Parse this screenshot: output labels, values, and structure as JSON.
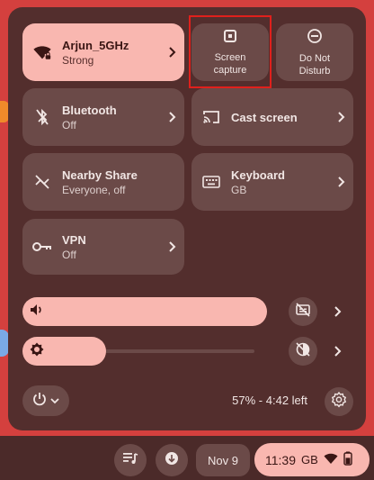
{
  "colors": {
    "wallpaper": "#d4403e",
    "panel": "#532e2d",
    "tile": "#6b4a48",
    "tile_active": "#f9b7b0",
    "shelf": "#4b2a29",
    "highlight": "#e0201c"
  },
  "tiles": {
    "wifi": {
      "title": "Arjun_5GHz",
      "subtitle": "Strong",
      "icon": "wifi-locked-icon",
      "active": true
    },
    "screen_capture": {
      "label": "Screen\ncapture",
      "icon": "screen-capture-icon"
    },
    "do_not_disturb": {
      "label": "Do Not\nDisturb",
      "icon": "do-not-disturb-icon"
    },
    "bluetooth": {
      "title": "Bluetooth",
      "subtitle": "Off",
      "icon": "bluetooth-off-icon"
    },
    "cast": {
      "title": "Cast screen",
      "icon": "cast-icon"
    },
    "nearby_share": {
      "title": "Nearby Share",
      "subtitle": "Everyone, off",
      "icon": "nearby-share-off-icon"
    },
    "keyboard": {
      "title": "Keyboard",
      "subtitle": "GB",
      "icon": "keyboard-icon"
    },
    "vpn": {
      "title": "VPN",
      "subtitle": "Off",
      "icon": "vpn-key-icon"
    }
  },
  "sliders": {
    "volume": {
      "icon": "volume-icon",
      "level": 1.0
    },
    "brightness": {
      "icon": "brightness-icon",
      "level": 0.36
    }
  },
  "footer": {
    "battery_text": "57% - 4:42 left",
    "power_icon": "power-icon",
    "settings_icon": "settings-gear-icon"
  },
  "shelf": {
    "date": "Nov 9",
    "time": "11:39",
    "keyboard_layout": "GB",
    "battery_level": 0.57
  }
}
